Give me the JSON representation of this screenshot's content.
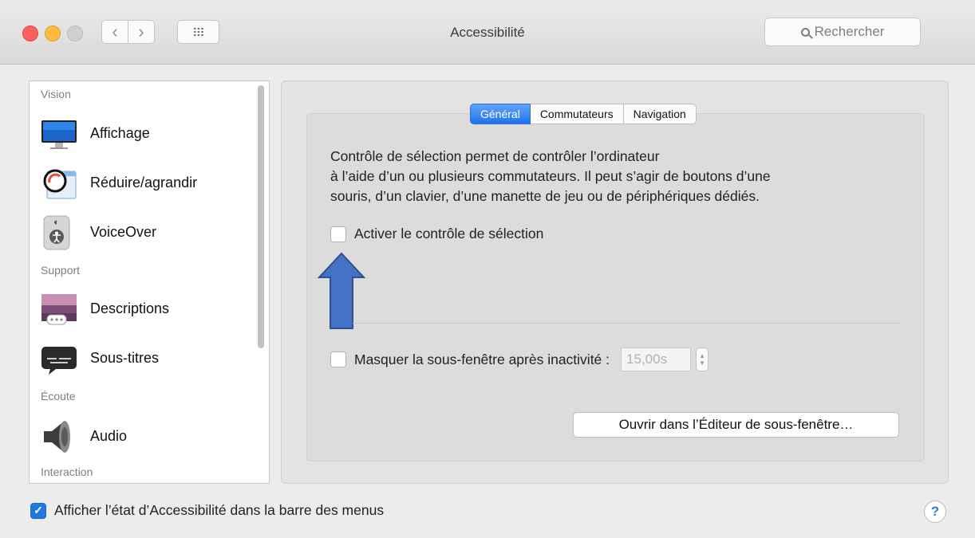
{
  "window": {
    "title": "Accessibilité"
  },
  "search": {
    "placeholder": "Rechercher"
  },
  "sidebar": {
    "sections": [
      "Vision",
      "Support",
      "Écoute",
      "Interaction"
    ],
    "items": [
      {
        "label": "Affichage",
        "icon": "display-icon"
      },
      {
        "label": "Réduire/agrandir",
        "icon": "zoom-icon"
      },
      {
        "label": "VoiceOver",
        "icon": "voiceover-icon"
      },
      {
        "label": "Descriptions",
        "icon": "descriptions-icon"
      },
      {
        "label": "Sous-titres",
        "icon": "subtitles-icon"
      },
      {
        "label": "Audio",
        "icon": "speaker-icon"
      }
    ]
  },
  "tabs": [
    "Général",
    "Commutateurs",
    "Navigation"
  ],
  "main": {
    "description_lines": [
      "Contrôle de sélection permet de contrôler l’ordinateur",
      "à l’aide d’un ou plusieurs commutateurs. Il peut s’agir de boutons d’une",
      "souris, d’un clavier, d’une manette de jeu ou de périphériques dédiés."
    ],
    "enable_label": "Activer le contrôle de sélection",
    "enable_checked": false,
    "hide_label": "Masquer la sous-fenêtre après inactivité :",
    "hide_checked": false,
    "hide_value": "15,00s",
    "open_editor_label": "Ouvrir dans l’Éditeur de sous-fenêtre…"
  },
  "footer": {
    "show_status_label": "Afficher l’état d’Accessibilité dans la barre des menus",
    "show_status_checked": true,
    "help_label": "?"
  },
  "colors": {
    "accent": "#1f7ae0",
    "annotation_arrow": "#4472c4"
  }
}
